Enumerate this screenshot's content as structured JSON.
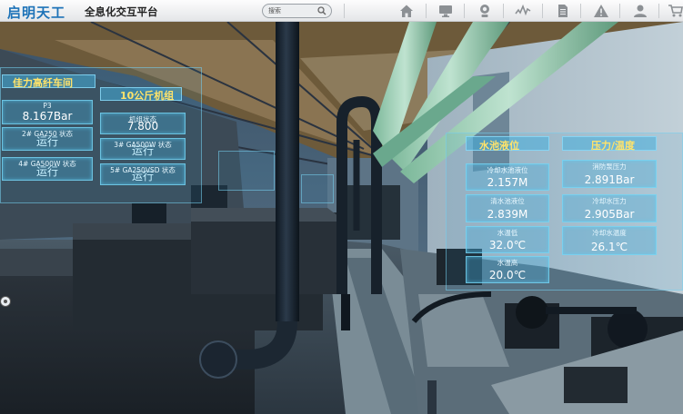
{
  "header": {
    "brand": "启明天工",
    "subtitle": "全息化交互平台",
    "search_placeholder": "搜索",
    "nav": [
      {
        "icon": "home-icon"
      },
      {
        "icon": "monitor-icon"
      },
      {
        "icon": "camera-icon"
      },
      {
        "icon": "trend-chart-icon"
      },
      {
        "icon": "document-icon"
      },
      {
        "icon": "warning-icon"
      },
      {
        "icon": "user-icon"
      },
      {
        "icon": "cart-icon"
      }
    ]
  },
  "panel_left": {
    "section1_title": "佳力高纤车间",
    "section2_title": "10公斤机组",
    "cells": [
      {
        "label": "P3",
        "value": "8.167Bar"
      },
      {
        "label": "机组状态",
        "value": "7.800"
      },
      {
        "label": "2# GA250 状态",
        "value": "运行"
      },
      {
        "label": "3# GA500W 状态",
        "value": "运行"
      },
      {
        "label": "4# GA500W 状态",
        "value": "运行"
      },
      {
        "label": "5# GA250VSD 状态",
        "value": "运行"
      }
    ]
  },
  "panel_right": {
    "section1_title": "水池液位",
    "section2_title": "压力/温度",
    "cells": [
      {
        "label": "冷却水池液位",
        "value": "2.157M"
      },
      {
        "label": "消防泵压力",
        "value": "2.891Bar"
      },
      {
        "label": "清水池液位",
        "value": "2.839M"
      },
      {
        "label": "冷却水压力",
        "value": "2.905Bar"
      },
      {
        "label": "水温低",
        "value": "32.0℃"
      },
      {
        "label": "冷却水温度",
        "value": "26.1℃"
      },
      {
        "label": "水温高",
        "value": "20.0℃"
      }
    ]
  },
  "colors": {
    "brand": "#1e73b8",
    "title_yellow": "#ffe36a",
    "holo_blue": "#46aad7"
  }
}
